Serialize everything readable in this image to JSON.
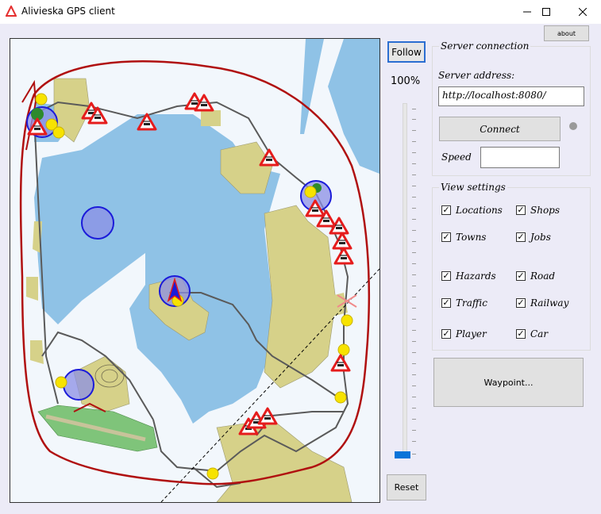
{
  "window": {
    "title": "Alivieska GPS client"
  },
  "controls": {
    "follow_label": "Follow",
    "zoom_level": "100%",
    "reset_label": "Reset",
    "about_label": "about"
  },
  "server": {
    "group_title": "Server connection",
    "address_label": "Server address:",
    "address_value": "http://localhost:8080/",
    "connect_label": "Connect",
    "speed_label": "Speed",
    "speed_value": ""
  },
  "view": {
    "group_title": "View settings",
    "options": [
      {
        "label": "Locations",
        "checked": true
      },
      {
        "label": "Shops",
        "checked": true
      },
      {
        "label": "Towns",
        "checked": true
      },
      {
        "label": "Jobs",
        "checked": true
      },
      {
        "label": "Hazards",
        "checked": true
      },
      {
        "label": "Road",
        "checked": true
      },
      {
        "label": "Traffic",
        "checked": true
      },
      {
        "label": "Railway",
        "checked": true
      },
      {
        "label": "Player",
        "checked": true
      },
      {
        "label": "Car",
        "checked": true
      }
    ]
  },
  "waypoint_label": "Waypoint...",
  "colors": {
    "water": "#8fc2e6",
    "land": "#d6d189",
    "road": "#555555",
    "border": "#b01010",
    "accent": "#2b6ed1",
    "status": "#9a9a9a"
  },
  "icons": [
    "app-warning-icon",
    "minimize-icon",
    "maximize-icon",
    "close-icon",
    "hazard-icon",
    "location-marker-icon",
    "player-arrow-icon"
  ]
}
